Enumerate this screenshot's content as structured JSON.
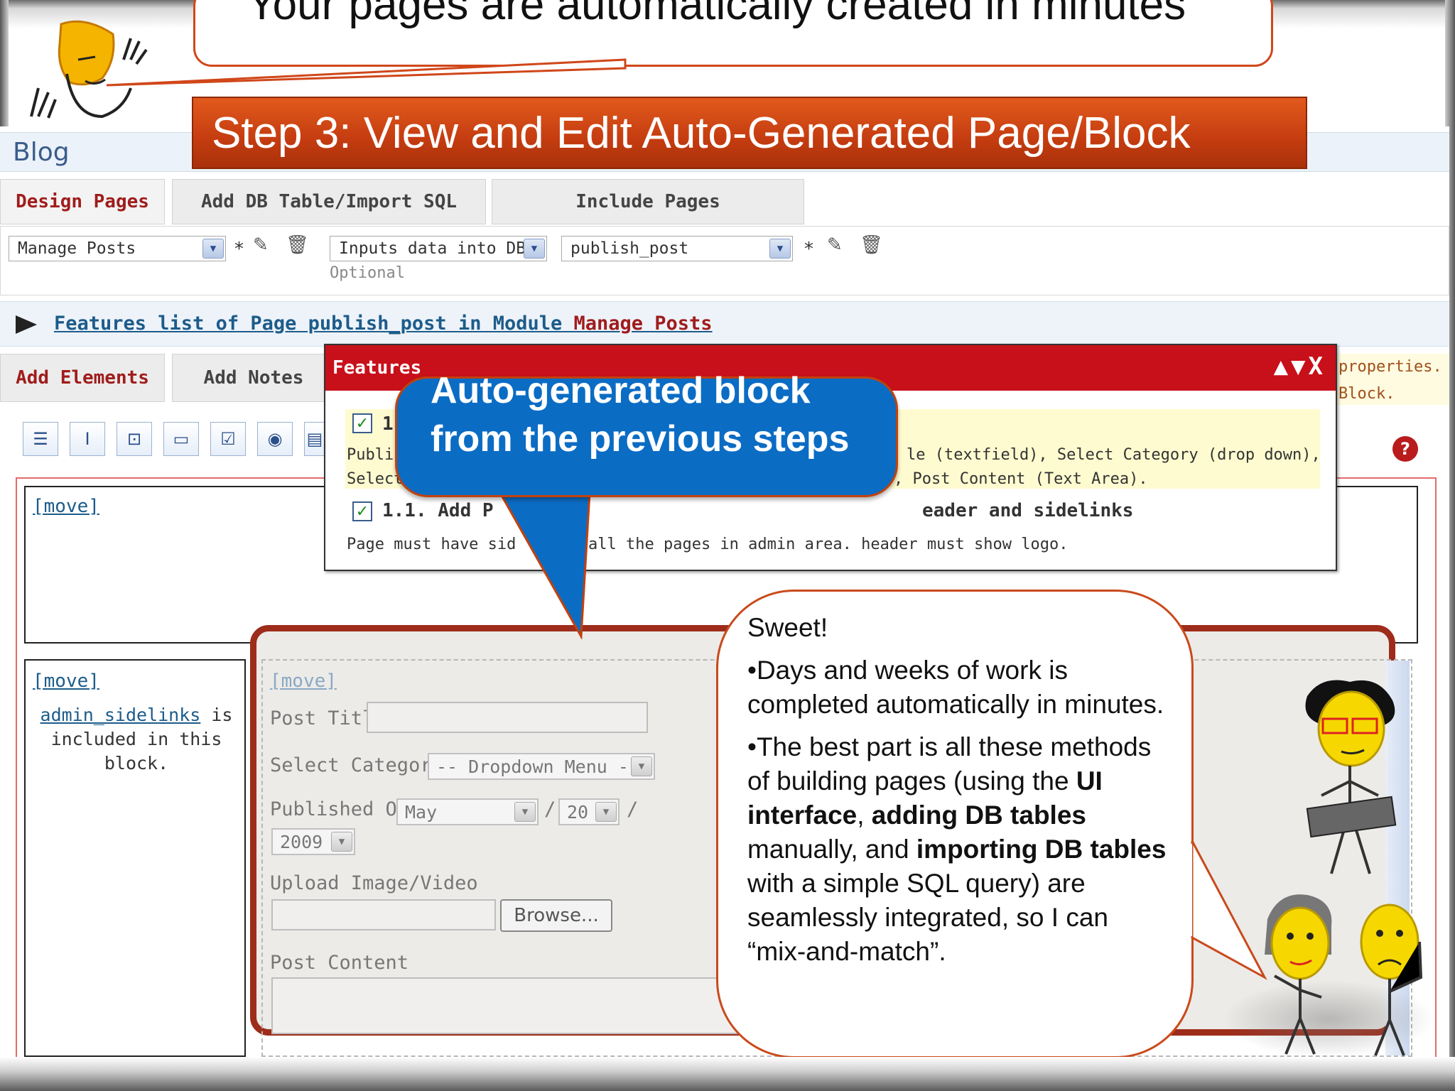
{
  "slide": {
    "title": "Your pages are automatically created in minutes",
    "step_banner": "Step 3: View and Edit Auto-Generated Page/Block",
    "blue_callout": "Auto-generated block from the previous steps",
    "speech": {
      "line1": "Sweet!",
      "bullet1": "•Days and weeks of work is completed automatically in minutes.",
      "b2_a": "•The best part is all these methods of building pages (using the ",
      "b2_ui": "UI interface",
      "b2_b": ", ",
      "b2_add": "adding DB tables",
      "b2_c": " manually, and ",
      "b2_imp": "importing DB tables",
      "b2_d": " with a simple SQL query) are seamlessly integrated, so I can “mix-and-match”."
    }
  },
  "app": {
    "blog_title": "Blog",
    "tabs": [
      "Design Pages",
      "Add DB Table/Import SQL",
      "Include Pages"
    ],
    "module_select": "Manage Posts",
    "purpose_select": "Inputs data into DB",
    "page_select": "publish_post",
    "required_mark": "*",
    "optional_label": "Optional",
    "features_link": {
      "prefix": "Features list of Page publish_post in Module ",
      "module": "Manage Posts"
    },
    "element_tabs": [
      "Add Elements",
      "Add Notes"
    ],
    "properties_note": {
      "line1": "properties.",
      "line2": "Block."
    },
    "help_icon": "?",
    "move_label": "[move]",
    "sidelinks_link": "admin_sidelinks",
    "sidelinks_note": " is included in this block."
  },
  "features_popup": {
    "title": "Features",
    "controls": "▲▼X",
    "item1_num": "1",
    "item1_desc_start": "Publis",
    "item1_desc_start2": "Select",
    "item1_desc_end": "le (textfield), Select Category (drop down),",
    "item1_desc_end2": ", Post Content (Text Area).",
    "item2_title_a": "1.1. Add P",
    "item2_title_b": "eader and sidelinks",
    "item2_desc_a": "Page must have sid",
    "item2_desc_b": " all the pages in admin area. header must show logo."
  },
  "form": {
    "post_title_label": "Post Title",
    "category_label": "Select Category",
    "category_value": "-- Dropdown Menu --",
    "published_label": "Published On",
    "month": "May",
    "day": "20",
    "year": "2009",
    "slash": "/",
    "upload_label": "Upload Image/Video",
    "browse_label": "Browse...",
    "content_label": "Post Content"
  },
  "colors": {
    "accent_red": "#c8101a",
    "banner_orange": "#d44a14",
    "callout_blue": "#0b6cc4",
    "frame_brown": "#9e2c1a"
  }
}
